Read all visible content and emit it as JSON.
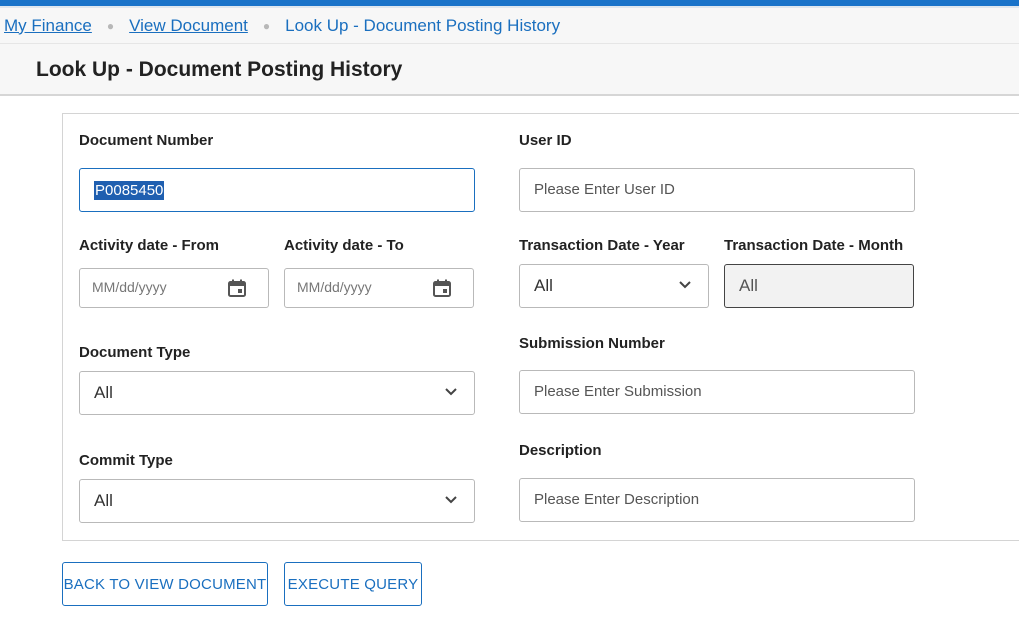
{
  "breadcrumb": {
    "items": [
      {
        "label": "My Finance"
      },
      {
        "label": "View Document"
      },
      {
        "label": "Look Up - Document Posting History"
      }
    ]
  },
  "page": {
    "title": "Look Up - Document Posting History"
  },
  "form": {
    "document_number": {
      "label": "Document Number",
      "value": "P0085450"
    },
    "user_id": {
      "label": "User ID",
      "placeholder": "Please Enter User ID"
    },
    "activity_date_from": {
      "label": "Activity date - From",
      "placeholder": "MM/dd/yyyy"
    },
    "activity_date_to": {
      "label": "Activity date - To",
      "placeholder": "MM/dd/yyyy"
    },
    "transaction_year": {
      "label": "Transaction Date - Year",
      "value": "All"
    },
    "transaction_month": {
      "label": "Transaction Date - Month",
      "value": "All"
    },
    "document_type": {
      "label": "Document Type",
      "value": "All"
    },
    "submission_number": {
      "label": "Submission Number",
      "placeholder": "Please Enter Submission"
    },
    "commit_type": {
      "label": "Commit Type",
      "value": "All"
    },
    "description": {
      "label": "Description",
      "placeholder": "Please Enter Description"
    }
  },
  "buttons": {
    "back": "BACK TO VIEW DOCUMENT",
    "execute": "EXECUTE QUERY"
  },
  "colors": {
    "accent": "#1a6fbf",
    "topbar": "#1a73c9",
    "selection": "#1f5fb0"
  },
  "icons": [
    "calendar-icon",
    "chevron-down-icon"
  ]
}
